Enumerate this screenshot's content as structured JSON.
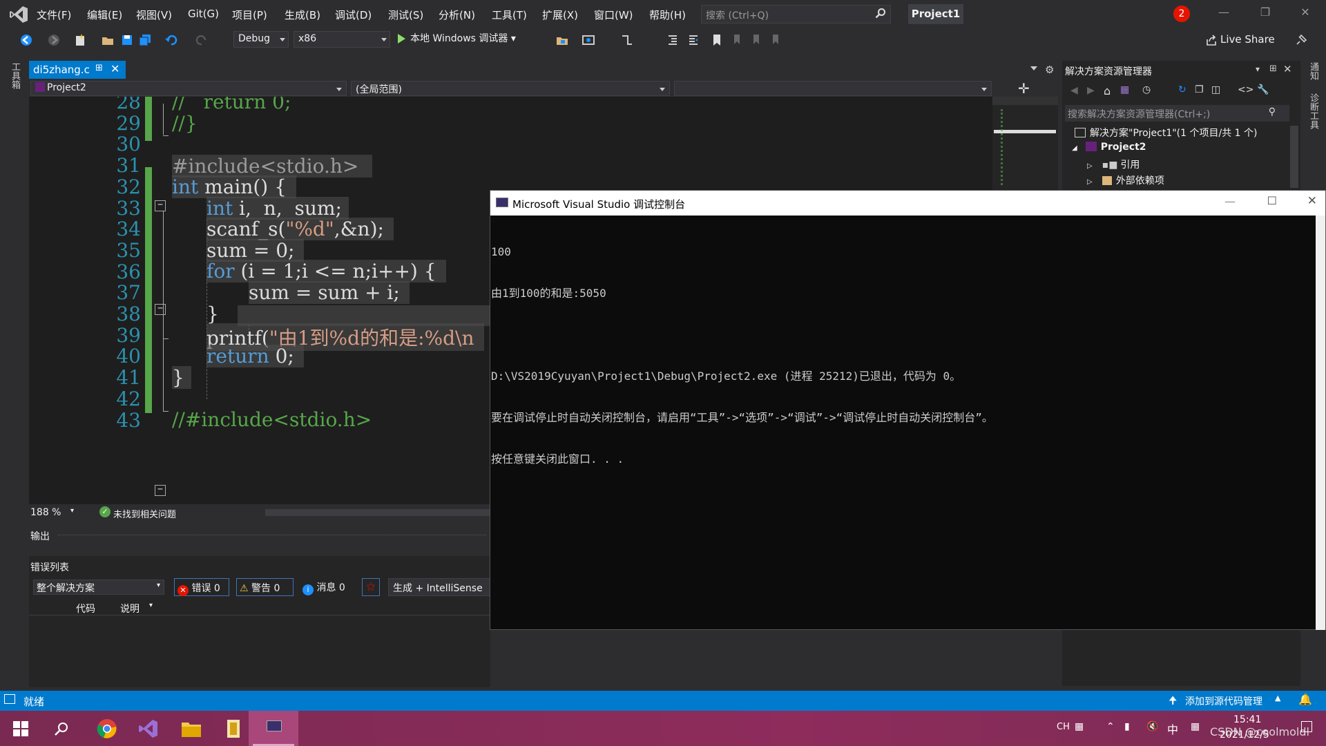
{
  "menubar": {
    "items": [
      "文件(F)",
      "编辑(E)",
      "视图(V)",
      "Git(G)",
      "项目(P)",
      "生成(B)",
      "调试(D)",
      "测试(S)",
      "分析(N)",
      "工具(T)",
      "扩展(X)",
      "窗口(W)",
      "帮助(H)"
    ],
    "search_placeholder": "搜索 (Ctrl+Q)",
    "project_name": "Project1",
    "notification_count": "2"
  },
  "toolbar": {
    "config": "Debug",
    "platform": "x86",
    "run_label": "本地 Windows 调试器",
    "live_share": "Live Share"
  },
  "left_strip": {
    "label": "工具箱"
  },
  "right_strip": {
    "labels": [
      "通知",
      "诊断工具"
    ]
  },
  "editor": {
    "tab_label": "di5zhang.c",
    "nav_project": "Project2",
    "nav_scope": "(全局范围)",
    "line_numbers": [
      "28",
      "29",
      "30",
      "31",
      "32",
      "33",
      "34",
      "35",
      "36",
      "37",
      "38",
      "39",
      "40",
      "41",
      "42",
      "43"
    ],
    "zoom": "188 %",
    "issues": "未找到相关问题"
  },
  "code": {
    "l28": "//   return 0;",
    "l29": "//}",
    "l31": "#include<stdio.h>",
    "l32a": "int",
    "l32b": " main() {",
    "l33a": "int",
    "l33b": " i,  n,  sum;",
    "l34a": "scanf_s(",
    "l34b": "\"%d\"",
    "l34c": ",&n);",
    "l35": "sum = 0;",
    "l36a": "for",
    "l36b": " (i = 1;i <= n;i++) {",
    "l37": "sum = sum + i;",
    "l38": "}",
    "l39a": "printf(",
    "l39b": "\"由1到%d的和是:%d\\n",
    "l40a": "return",
    "l40b": " 0;",
    "l41": "}",
    "l43": "//#include<stdio.h>"
  },
  "output_panel": {
    "title": "输出"
  },
  "error_list": {
    "title": "错误列表",
    "scope": "整个解决方案",
    "errors": "错误 0",
    "warnings": "警告 0",
    "messages": "消息 0",
    "build_filter": "生成 + IntelliSense",
    "col_code": "代码",
    "col_desc": "说明"
  },
  "solution_explorer": {
    "title": "解决方案资源管理器",
    "search_placeholder": "搜索解决方案资源管理器(Ctrl+;)",
    "solution_label": "解决方案\"Project1\"(1 个项目/共 1 个)",
    "project": "Project2",
    "references": "引用",
    "external_deps": "外部依赖项"
  },
  "console": {
    "title": "Microsoft Visual Studio 调试控制台",
    "lines": [
      "100",
      "由1到100的和是:5050",
      "",
      "D:\\VS2019Cyuyan\\Project1\\Debug\\Project2.exe (进程 25212)已退出，代码为 0。",
      "要在调试停止时自动关闭控制台，请启用“工具”->“选项”->“调试”->“调试停止时自动关闭控制台”。",
      "按任意键关闭此窗口. . ."
    ]
  },
  "statusbar": {
    "ready": "就绪",
    "source_control": "添加到源代码管理"
  },
  "taskbar": {
    "ime1": "CH",
    "ime2": "中",
    "time": "15:41",
    "date": "2021/12/5",
    "watermark": "CSDN @coolmoldl"
  },
  "colors": {
    "accent": "#007acc",
    "keyword": "#569cd6",
    "string": "#d69d85",
    "comment": "#57a64a",
    "line_number": "#2b91af"
  }
}
